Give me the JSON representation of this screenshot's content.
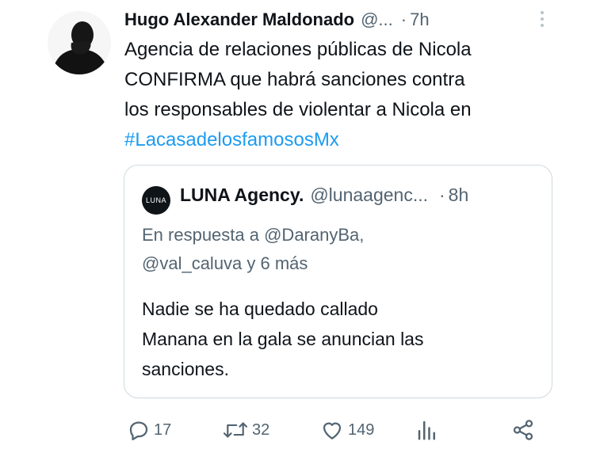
{
  "tweet": {
    "author_name": "Hugo Alexander Maldonado",
    "handle": "@...",
    "separator": "·",
    "time": "7h",
    "text_lines": [
      "Agencia de relaciones públicas de Nicola",
      "CONFIRMA que habrá sanciones contra",
      "los responsables de violentar a Nicola en"
    ],
    "hashtag": "#LacasadelosfamososMx"
  },
  "quote": {
    "avatar_text": "LUNA",
    "author_name": "LUNA Agency.",
    "handle": "@lunaagenc...",
    "separator": "·",
    "time": "8h",
    "reply_lines": [
      "En respuesta a @DaranyBa,",
      "@val_caluva y 6 más"
    ],
    "text_lines": [
      "Nadie se ha quedado callado",
      "Manana en la gala se anuncian las",
      "sanciones."
    ]
  },
  "actions": {
    "replies": "17",
    "retweets": "32",
    "likes": "149"
  },
  "icons": [
    "more-icon",
    "reply-icon",
    "retweet-icon",
    "like-icon",
    "views-icon",
    "share-icon"
  ],
  "colors": {
    "text": "#0f1419",
    "secondary": "#536471",
    "link": "#1d9bf0",
    "border": "#cfd9de"
  }
}
